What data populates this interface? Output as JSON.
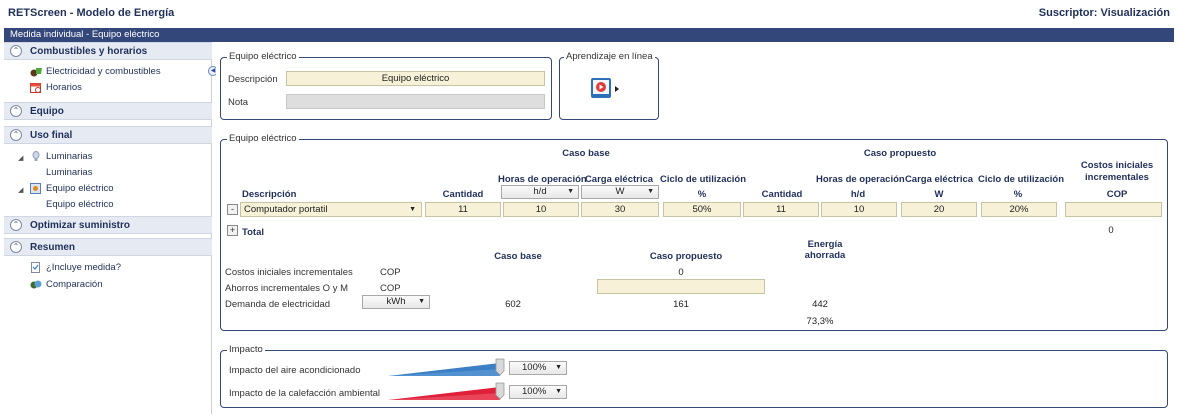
{
  "app": {
    "title": "RETScreen - Modelo de Energía",
    "subscriber": "Suscriptor: Visualización"
  },
  "header": {
    "breadcrumb": "Medida individual - Equipo eléctrico"
  },
  "sidebar": {
    "sections": [
      {
        "label": "Combustibles y horarios"
      },
      {
        "label": "Equipo"
      },
      {
        "label": "Uso final"
      },
      {
        "label": "Optimizar suministro"
      },
      {
        "label": "Resumen"
      }
    ],
    "items": {
      "electricidad": "Electricidad y combustibles",
      "horarios": "Horarios",
      "luminarias": "Luminarias",
      "luminarias_sub": "Luminarias",
      "equipo_electrico": "Equipo eléctrico",
      "equipo_electrico_sub": "Equipo eléctrico",
      "incluye": "¿Incluye medida?",
      "comparacion": "Comparación"
    }
  },
  "equipo_box": {
    "legend": "Equipo eléctrico",
    "descripcion_label": "Descripción",
    "descripcion_value": "Equipo eléctrico",
    "nota_label": "Nota"
  },
  "aprendizaje": {
    "legend": "Aprendizaje en línea"
  },
  "table_box": {
    "legend": "Equipo eléctrico",
    "caso_base": "Caso base",
    "caso_propuesto": "Caso propuesto",
    "costos_line1": "Costos iniciales",
    "costos_line2": "incrementales",
    "horas_header": "Horas de operación",
    "carga_header": "Carga eléctrica",
    "ciclo_header": "Ciclo de utilización",
    "descripcion_header": "Descripción",
    "cantidad_header": "Cantidad",
    "horas_unit": "h/d",
    "carga_unit": "W",
    "ciclo_unit": "%",
    "cop_unit": "COP",
    "row": {
      "descripcion": "Computador portatil",
      "base_cantidad": "11",
      "base_horas": "10",
      "base_carga": "30",
      "base_ciclo": "50%",
      "prop_cantidad": "11",
      "prop_horas": "10",
      "prop_carga": "20",
      "prop_ciclo": "20%",
      "costos": ""
    },
    "total_label": "Total",
    "total_value": "0",
    "summary": {
      "caso_base": "Caso base",
      "caso_propuesto": "Caso propuesto",
      "energia_line1": "Energía",
      "energia_line2": "ahorrada",
      "costos_label": "Costos iniciales incrementales",
      "costos_unit": "COP",
      "costos_prop": "0",
      "ahorros_label": "Ahorros incrementales O y M",
      "ahorros_unit": "COP",
      "demanda_label": "Demanda de electricidad",
      "demanda_unit": "kWh",
      "demanda_base": "602",
      "demanda_prop": "161",
      "demanda_ahorro": "442",
      "demanda_pct": "73,3%"
    }
  },
  "impacto": {
    "legend": "Impacto",
    "aire_label": "Impacto del aire acondicionado",
    "aire_value": "100%",
    "calef_label": "Impacto de la calefacción ambiental",
    "calef_value": "100%"
  },
  "colors": {
    "header_bg": "#34477a",
    "input_bg": "#f7f1d8",
    "aire_wedge": "#3b7fc4",
    "calef_wedge": "#e0203a"
  }
}
